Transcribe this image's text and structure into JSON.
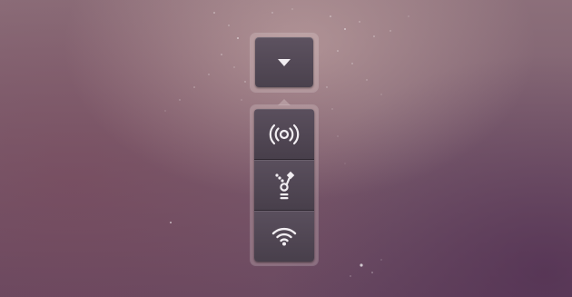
{
  "menu": {
    "trigger_icon": "chevron-down-icon",
    "items": [
      {
        "id": "broadcast",
        "icon": "broadcast-icon"
      },
      {
        "id": "firewire",
        "icon": "firewire-icon"
      },
      {
        "id": "wifi",
        "icon": "wifi-icon"
      }
    ]
  },
  "colors": {
    "icon": "#f2eef2",
    "button_top": "#5d5260",
    "button_bottom": "#4a414d",
    "background_top": "#8c6f7a",
    "background_bottom": "#6a4b62"
  }
}
